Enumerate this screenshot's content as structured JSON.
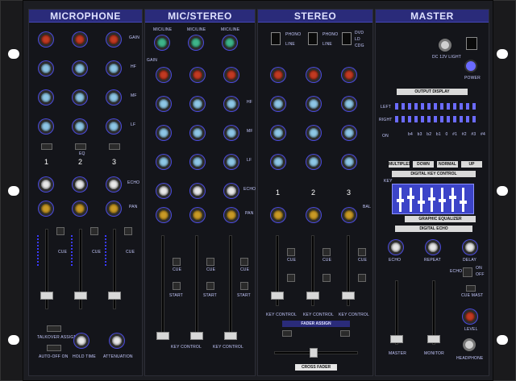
{
  "sections": {
    "microphone": "MICROPHONE",
    "mic_stereo": "MIC/STEREO",
    "stereo": "STEREO",
    "master": "MASTER"
  },
  "labels": {
    "gain": "GAIN",
    "hf": "HF",
    "mf": "MF",
    "lf": "LF",
    "eq": "EQ",
    "echo": "ECHO",
    "pan": "PAN",
    "bal": "BAL",
    "cue": "CUE",
    "start": "START",
    "mic_line": "MIC/LINE",
    "phono": "PHONO",
    "line": "LINE",
    "dvd": "DVD",
    "ld": "LD",
    "cdg": "CDG",
    "talkover_assign": "TALKOVER ASSIGN",
    "auto_off_on": "AUTO-OFF  ON",
    "hold_time": "HOLD TIME",
    "attenuation": "ATTENUATION",
    "key_control": "KEY CONTROL",
    "fader_assign": "FADER ASSIGN",
    "cross_fader": "CROSS FADER",
    "dc_12v_light": "DC 12V LIGHT",
    "power": "POWER",
    "output_display": "OUTPUT DISPLAY",
    "left": "LEFT",
    "right": "RIGHT",
    "on": "ON",
    "multiplex": "MULTIPLEX",
    "down": "DOWN",
    "normal": "NORMAL",
    "up": "UP",
    "digital_key_control": "DIGITAL KEY CONTROL",
    "key": "KEY",
    "graphic_equalizer": "GRAPHIC EQUALIZER",
    "digital_echo": "DIGITAL ECHO",
    "repeat": "REPEAT",
    "delay": "DELAY",
    "off": "OFF",
    "cue_mast": "CUE MAST",
    "level": "LEVEL",
    "master_fader": "MASTER",
    "monitor": "MONITOR",
    "headphone": "HEADPHONE"
  },
  "key_steps": [
    "b4",
    "b3",
    "b2",
    "b1",
    "0",
    "#1",
    "#2",
    "#3",
    "#4"
  ],
  "channel_numbers": [
    "1",
    "2",
    "3"
  ]
}
